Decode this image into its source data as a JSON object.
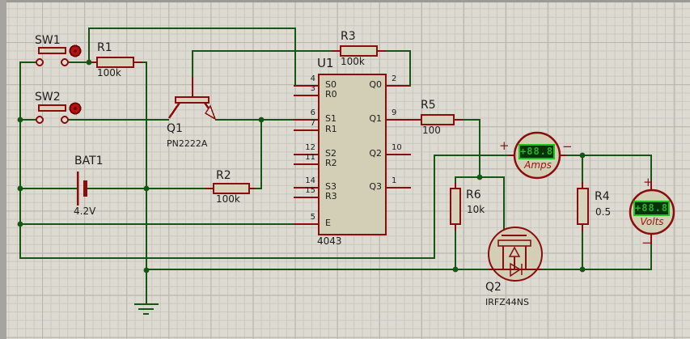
{
  "components": {
    "sw1": {
      "ref": "SW1"
    },
    "sw2": {
      "ref": "SW2"
    },
    "r1": {
      "ref": "R1",
      "value": "100k"
    },
    "r2": {
      "ref": "R2",
      "value": "100k"
    },
    "r3": {
      "ref": "R3",
      "value": "100k"
    },
    "r5": {
      "ref": "R5",
      "value": "100"
    },
    "r6": {
      "ref": "R6",
      "value": "10k"
    },
    "r4": {
      "ref": "R4",
      "value": "0.5"
    },
    "bat1": {
      "ref": "BAT1",
      "value": "4.2V"
    },
    "q1": {
      "ref": "Q1",
      "value": "PN2222A"
    },
    "q2": {
      "ref": "Q2",
      "value": "IRFZ44NS"
    },
    "u1": {
      "ref": "U1",
      "part": "4043"
    }
  },
  "ic": {
    "left_pins": [
      {
        "num": "4",
        "name": "S0"
      },
      {
        "num": "3",
        "name": "R0"
      },
      {
        "num": "6",
        "name": "S1"
      },
      {
        "num": "7",
        "name": "R1"
      },
      {
        "num": "12",
        "name": "S2"
      },
      {
        "num": "11",
        "name": "R2"
      },
      {
        "num": "14",
        "name": "S3"
      },
      {
        "num": "15",
        "name": "R3"
      },
      {
        "num": "5",
        "name": "E"
      }
    ],
    "right_pins": [
      {
        "num": "2",
        "name": "Q0"
      },
      {
        "num": "9",
        "name": "Q1"
      },
      {
        "num": "10",
        "name": "Q2"
      },
      {
        "num": "1",
        "name": "Q3"
      }
    ]
  },
  "meters": {
    "ammeter": {
      "reading": "+88.8",
      "label": "Amps",
      "plus": "+",
      "minus": "−"
    },
    "voltmeter": {
      "reading": "+88.8",
      "label": "Volts",
      "plus": "+",
      "minus": "−"
    }
  },
  "colors": {
    "wire": "#155615",
    "component_outline": "#8a0c0c",
    "component_fill": "#d6d3ba",
    "lcd_bg": "#06330a",
    "lcd_border": "#17c617",
    "lcd_text": "#2ab32a",
    "canvas_bg": "#dcdad1"
  }
}
